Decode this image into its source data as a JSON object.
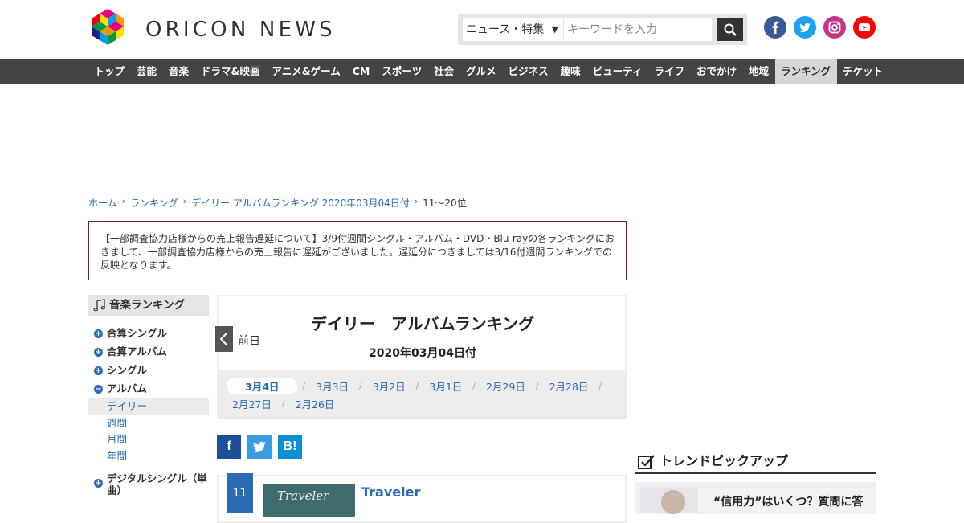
{
  "header": {
    "logo_text": "ORICON NEWS",
    "search": {
      "category": "ニュース・特集",
      "placeholder": "キーワードを入力"
    },
    "social": [
      "facebook-icon",
      "twitter-icon",
      "instagram-icon",
      "youtube-icon"
    ]
  },
  "nav": {
    "items": [
      "トップ",
      "芸能",
      "音楽",
      "ドラマ&映画",
      "アニメ&ゲーム",
      "CM",
      "スポーツ",
      "社会",
      "グルメ",
      "ビジネス",
      "趣味",
      "ビューティ",
      "ライフ",
      "おでかけ",
      "地域",
      "ランキング",
      "チケット"
    ],
    "active": "ランキング"
  },
  "breadcrumb": {
    "home": "ホーム",
    "ranking": "ランキング",
    "daily": "デイリー アルバムランキング 2020年03月04日付",
    "current": "11～20位"
  },
  "notice": "【一部調査協力店様からの売上報告遅延について】3/9付週間シングル・アルバム・DVD・Blu-rayの各ランキングにおきまして、一部調査協力店様からの売上報告に遅延がございました。遅延分につきましては3/16付週間ランキングでの反映となります。",
  "sidebar": {
    "title": "音楽ランキング",
    "items": {
      "combined_single": "合算シングル",
      "combined_album": "合算アルバム",
      "single": "シングル",
      "album": "アルバム",
      "daily": "デイリー",
      "weekly": "週間",
      "monthly": "月間",
      "yearly": "年間",
      "digital_single": "デジタルシングル（単曲）"
    }
  },
  "main": {
    "title": "デイリー　アルバムランキング",
    "date": "2020年03月04日付",
    "prev_label": "前日",
    "dates_row1": [
      "3月4日",
      "3月3日",
      "3月2日",
      "3月1日",
      "2月29日",
      "2月28日"
    ],
    "dates_row2": [
      "2月27日",
      "2月26日"
    ],
    "current_date": "3月4日"
  },
  "share": {
    "facebook": "f",
    "hatena": "B!"
  },
  "ranking": {
    "rank": "11",
    "title": "Traveler",
    "thumb_title": "Traveler"
  },
  "trend": {
    "title": "トレンドピックアップ",
    "first_item": "“信用力”はいくつ？質問に答"
  },
  "colors": {
    "link": "#2a6bb3",
    "nav_bg": "#444444",
    "notice_border": "#7a1c1c"
  }
}
